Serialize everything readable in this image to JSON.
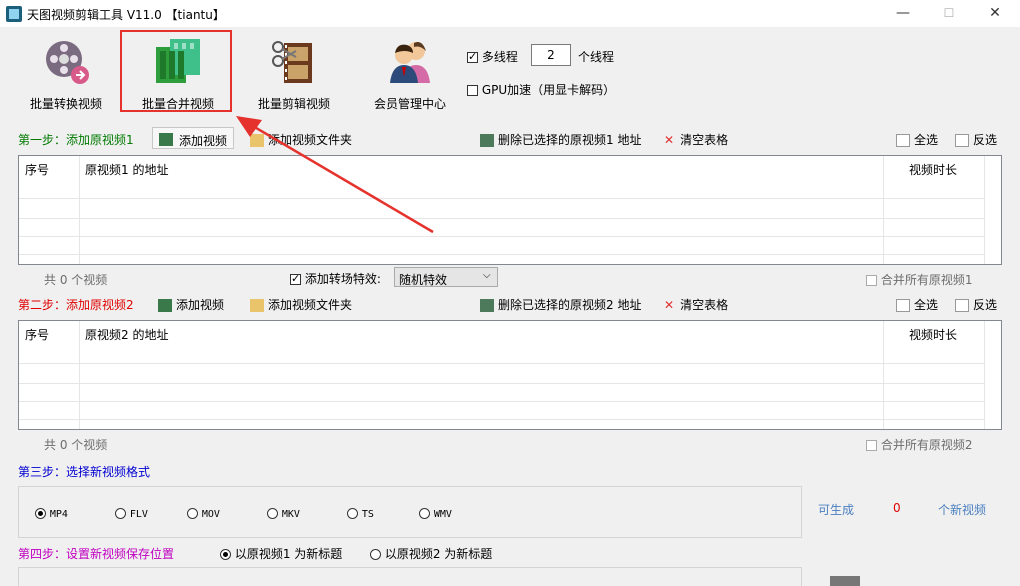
{
  "window": {
    "title": "天图视频剪辑工具 V11.0 【tiantu】",
    "min_glyph": "—",
    "max_glyph": "☐",
    "close_glyph": "✕"
  },
  "toolbar": {
    "batch_convert": "批量转换视频",
    "batch_merge": "批量合并视频",
    "batch_cut": "批量剪辑视频",
    "member": "会员管理中心",
    "multithread_label": "多线程",
    "thread_count": "2",
    "thread_unit": "个线程",
    "gpu_label": "GPU加速（用显卡解码）"
  },
  "step1": {
    "title": "第一步：添加原视频1",
    "add_video": "添加视频",
    "add_folder": "添加视频文件夹",
    "delete_selected": "删除已选择的原视频1 地址",
    "clear_table": "清空表格",
    "select_all": "全选",
    "invert": "反选",
    "columns": [
      "序号",
      "原视频1 的地址",
      "视频时长"
    ],
    "count_text": "共 0 个视频",
    "transition_label": "添加转场特效:",
    "transition_value": "随机特效",
    "merge_all": "合并所有原视频1"
  },
  "step2": {
    "title": "第二步：添加原视频2",
    "add_video": "添加视频",
    "add_folder": "添加视频文件夹",
    "delete_selected": "删除已选择的原视频2 地址",
    "clear_table": "清空表格",
    "select_all": "全选",
    "invert": "反选",
    "columns": [
      "序号",
      "原视频2 的地址",
      "视频时长"
    ],
    "count_text": "共 0 个视频",
    "merge_all": "合并所有原视频2"
  },
  "step3": {
    "title": "第三步：选择新视频格式",
    "formats": [
      "MP4",
      "FLV",
      "MOV",
      "MKV",
      "TS",
      "WMV"
    ],
    "selected": "MP4",
    "can_generate": "可生成",
    "count": "0",
    "new_videos": "个新视频"
  },
  "step4": {
    "title": "第四步：设置新视频保存位置",
    "option1": "以原视频1 为新标题",
    "option2": "以原视频2 为新标题"
  },
  "colors": {
    "highlight": "#e5322d",
    "arrow": "#e5322d",
    "step1": "#007a00",
    "step2": "#e00000",
    "step3": "#0000d0",
    "step4": "#c000c0"
  }
}
